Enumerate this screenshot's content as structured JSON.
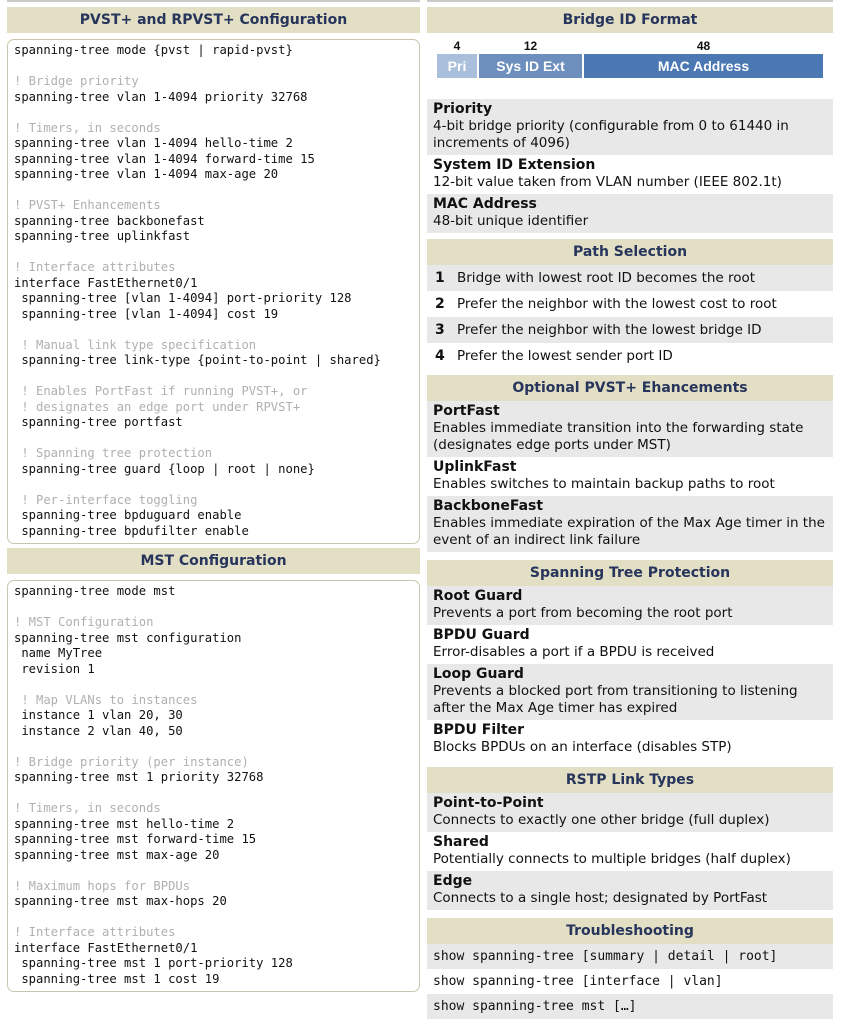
{
  "pvst": {
    "title": "PVST+ and RPVST+ Configuration",
    "lines": [
      {
        "t": "spanning-tree mode {pvst | rapid-pvst}",
        "c": false
      },
      {
        "t": "",
        "c": false
      },
      {
        "t": "! Bridge priority",
        "c": true
      },
      {
        "t": "spanning-tree vlan 1-4094 priority 32768",
        "c": false
      },
      {
        "t": "",
        "c": false
      },
      {
        "t": "! Timers, in seconds",
        "c": true
      },
      {
        "t": "spanning-tree vlan 1-4094 hello-time 2",
        "c": false
      },
      {
        "t": "spanning-tree vlan 1-4094 forward-time 15",
        "c": false
      },
      {
        "t": "spanning-tree vlan 1-4094 max-age 20",
        "c": false
      },
      {
        "t": "",
        "c": false
      },
      {
        "t": "! PVST+ Enhancements",
        "c": true
      },
      {
        "t": "spanning-tree backbonefast",
        "c": false
      },
      {
        "t": "spanning-tree uplinkfast",
        "c": false
      },
      {
        "t": "",
        "c": false
      },
      {
        "t": "! Interface attributes",
        "c": true
      },
      {
        "t": "interface FastEthernet0/1",
        "c": false
      },
      {
        "t": " spanning-tree [vlan 1-4094] port-priority 128",
        "c": false
      },
      {
        "t": " spanning-tree [vlan 1-4094] cost 19",
        "c": false
      },
      {
        "t": "",
        "c": false
      },
      {
        "t": " ! Manual link type specification",
        "c": true
      },
      {
        "t": " spanning-tree link-type {point-to-point | shared}",
        "c": false
      },
      {
        "t": "",
        "c": false
      },
      {
        "t": " ! Enables PortFast if running PVST+, or",
        "c": true
      },
      {
        "t": " ! designates an edge port under RPVST+",
        "c": true
      },
      {
        "t": " spanning-tree portfast",
        "c": false
      },
      {
        "t": "",
        "c": false
      },
      {
        "t": " ! Spanning tree protection",
        "c": true
      },
      {
        "t": " spanning-tree guard {loop | root | none}",
        "c": false
      },
      {
        "t": "",
        "c": false
      },
      {
        "t": " ! Per-interface toggling",
        "c": true
      },
      {
        "t": " spanning-tree bpduguard enable",
        "c": false
      },
      {
        "t": " spanning-tree bpdufilter enable",
        "c": false
      }
    ]
  },
  "mst": {
    "title": "MST Configuration",
    "lines": [
      {
        "t": "spanning-tree mode mst",
        "c": false
      },
      {
        "t": "",
        "c": false
      },
      {
        "t": "! MST Configuration",
        "c": true
      },
      {
        "t": "spanning-tree mst configuration",
        "c": false
      },
      {
        "t": " name MyTree",
        "c": false
      },
      {
        "t": " revision 1",
        "c": false
      },
      {
        "t": "",
        "c": false
      },
      {
        "t": " ! Map VLANs to instances",
        "c": true
      },
      {
        "t": " instance 1 vlan 20, 30",
        "c": false
      },
      {
        "t": " instance 2 vlan 40, 50",
        "c": false
      },
      {
        "t": "",
        "c": false
      },
      {
        "t": "! Bridge priority (per instance)",
        "c": true
      },
      {
        "t": "spanning-tree mst 1 priority 32768",
        "c": false
      },
      {
        "t": "",
        "c": false
      },
      {
        "t": "! Timers, in seconds",
        "c": true
      },
      {
        "t": "spanning-tree mst hello-time 2",
        "c": false
      },
      {
        "t": "spanning-tree mst forward-time 15",
        "c": false
      },
      {
        "t": "spanning-tree mst max-age 20",
        "c": false
      },
      {
        "t": "",
        "c": false
      },
      {
        "t": "! Maximum hops for BPDUs",
        "c": true
      },
      {
        "t": "spanning-tree mst max-hops 20",
        "c": false
      },
      {
        "t": "",
        "c": false
      },
      {
        "t": "! Interface attributes",
        "c": true
      },
      {
        "t": "interface FastEthernet0/1",
        "c": false
      },
      {
        "t": " spanning-tree mst 1 port-priority 128",
        "c": false
      },
      {
        "t": " spanning-tree mst 1 cost 19",
        "c": false
      }
    ]
  },
  "bridge_id": {
    "title": "Bridge ID Format",
    "segments": [
      {
        "bits": "4",
        "label": "Pri",
        "color": "#a9bfdb"
      },
      {
        "bits": "12",
        "label": "Sys ID Ext",
        "color": "#6c8fbe"
      },
      {
        "bits": "48",
        "label": "MAC Address",
        "color": "#4b78b3"
      }
    ],
    "items": [
      {
        "title": "Priority",
        "desc": "4-bit bridge priority (configurable from 0 to 61440 in increments of 4096)"
      },
      {
        "title": "System ID Extension",
        "desc": "12-bit value taken from VLAN number (IEEE 802.1t)"
      },
      {
        "title": "MAC Address",
        "desc": "48-bit unique identifier"
      }
    ]
  },
  "path_selection": {
    "title": "Path Selection",
    "steps": [
      {
        "n": "1",
        "text": "Bridge with lowest root ID becomes the root"
      },
      {
        "n": "2",
        "text": "Prefer the neighbor with the lowest cost to root"
      },
      {
        "n": "3",
        "text": "Prefer the neighbor with the lowest bridge ID"
      },
      {
        "n": "4",
        "text": "Prefer the lowest sender port ID"
      }
    ]
  },
  "optional": {
    "title": "Optional PVST+ Ehancements",
    "items": [
      {
        "title": "PortFast",
        "desc": "Enables immediate transition into the forwarding state (designates edge ports under MST)"
      },
      {
        "title": "UplinkFast",
        "desc": "Enables switches to maintain backup paths to root"
      },
      {
        "title": "BackboneFast",
        "desc": "Enables immediate expiration of the Max Age timer in the event of an indirect link failure"
      }
    ]
  },
  "protection": {
    "title": "Spanning Tree Protection",
    "items": [
      {
        "title": "Root Guard",
        "desc": "Prevents a port from becoming the root port"
      },
      {
        "title": "BPDU Guard",
        "desc": "Error-disables a port if a BPDU is received"
      },
      {
        "title": "Loop Guard",
        "desc": "Prevents a blocked port from transitioning to listening after the Max Age timer has expired"
      },
      {
        "title": "BPDU Filter",
        "desc": "Blocks BPDUs on an interface (disables STP)"
      }
    ]
  },
  "rstp": {
    "title": "RSTP Link Types",
    "items": [
      {
        "title": "Point-to-Point",
        "desc": "Connects to exactly one other bridge (full duplex)"
      },
      {
        "title": "Shared",
        "desc": "Potentially connects to multiple bridges (half duplex)"
      },
      {
        "title": "Edge",
        "desc": "Connects to a single host; designated by PortFast"
      }
    ]
  },
  "troubleshooting": {
    "title": "Troubleshooting",
    "commands": [
      "show spanning-tree [summary | detail | root]",
      "show spanning-tree [interface | vlan]",
      "show spanning-tree mst […]"
    ]
  },
  "colors": {
    "header_bg": "#e2dfc4",
    "header_text": "#27345c",
    "row_shade": "#e8e8e8",
    "comment": "#b0b0b0"
  }
}
